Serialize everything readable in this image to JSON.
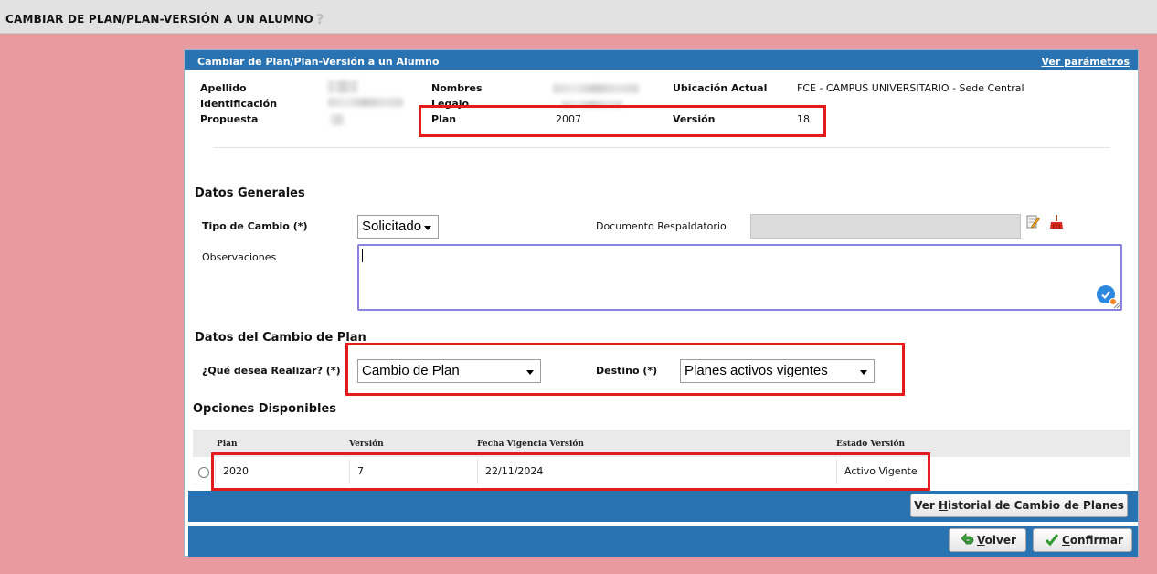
{
  "page": {
    "title": "CAMBIAR DE PLAN/PLAN-VERSIÓN A UN ALUMNO"
  },
  "panel": {
    "title": "Cambiar de Plan/Plan-Versión a un Alumno",
    "params_link": "Ver parámetros"
  },
  "student": {
    "apellido_label": "Apellido",
    "identificacion_label": "Identificación",
    "propuesta_label": "Propuesta",
    "nombres_label": "Nombres",
    "legajo_label": "Legajo",
    "plan_label": "Plan",
    "plan_value": "2007",
    "ubicacion_label": "Ubicación Actual",
    "ubicacion_value": "FCE - CAMPUS UNIVERSITARIO - Sede Central",
    "version_label": "Versión",
    "version_value": "18"
  },
  "general": {
    "title": "Datos Generales",
    "tipo_label": "Tipo de Cambio (*)",
    "tipo_value": "Solicitado",
    "documento_label": "Documento Respaldatorio",
    "observaciones_label": "Observaciones",
    "observaciones_value": ""
  },
  "cambio": {
    "title": "Datos del Cambio de Plan",
    "realizar_label": "¿Qué desea Realizar? (*)",
    "realizar_value": "Cambio de Plan",
    "destino_label": "Destino (*)",
    "destino_value": "Planes activos vigentes"
  },
  "opciones": {
    "title": "Opciones Disponibles",
    "headers": [
      "Plan",
      "Versión",
      "Fecha Vigencia Versión",
      "Estado Versión"
    ],
    "rows": [
      {
        "plan": "2020",
        "version": "7",
        "fecha": "22/11/2024",
        "estado": "Activo Vigente"
      }
    ]
  },
  "buttons": {
    "historial_prefix": "Ver ",
    "historial_underlined": "H",
    "historial_suffix": "istorial de Cambio de Planes",
    "volver_underlined": "V",
    "volver_suffix": "olver",
    "confirmar_underlined": "C",
    "confirmar_suffix": "onfirmar"
  },
  "icons": {
    "help": "question-icon",
    "edit": "edit-document-icon",
    "clear": "broom-clear-icon",
    "back": "back-arrow-icon",
    "confirm": "checkmark-icon"
  },
  "colors": {
    "accent": "#2a73b3",
    "background": "#e89a9e",
    "highlight": "#e31b1b"
  }
}
